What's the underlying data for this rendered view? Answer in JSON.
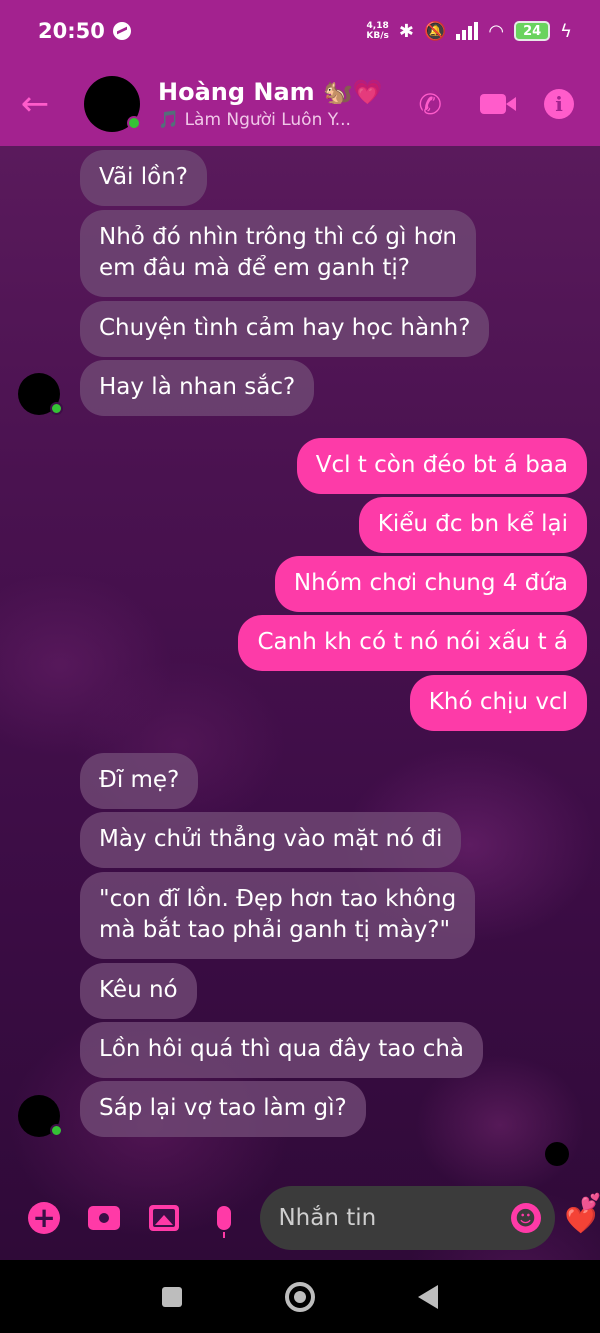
{
  "status_bar": {
    "time": "20:50",
    "net_speed_value": "4,18",
    "net_speed_unit": "KB/s",
    "battery": "24"
  },
  "header": {
    "name": "Hoàng Nam 🐿️💗",
    "subtitle": "🎵 Làm Người Luôn Y...",
    "back_icon": "back-arrow-icon",
    "call_icon": "phone-icon",
    "video_icon": "video-icon",
    "info_icon": "info-icon"
  },
  "messages": [
    {
      "side": "in",
      "text": "Vãi lồn?"
    },
    {
      "side": "in",
      "text": "Nhỏ đó nhìn trông thì có gì hơn\nem đâu mà để em ganh tị?"
    },
    {
      "side": "in",
      "text": "Chuyện tình cảm hay học hành?"
    },
    {
      "side": "in",
      "text": "Hay là nhan sắc?"
    },
    {
      "side": "out",
      "text": "Vcl t còn đéo bt á baa"
    },
    {
      "side": "out",
      "text": "Kiểu đc bn kể lại"
    },
    {
      "side": "out",
      "text": "Nhóm chơi chung 4 đứa"
    },
    {
      "side": "out",
      "text": "Canh kh có t nó nói xấu t á"
    },
    {
      "side": "out",
      "text": "Khó chịu vcl"
    },
    {
      "side": "in",
      "text": "Đĩ mẹ?"
    },
    {
      "side": "in",
      "text": "Mày chửi thẳng vào mặt nó đi"
    },
    {
      "side": "in",
      "text": "\"con đĩ lồn. Đẹp hơn tao không\nmà bắt tao phải ganh tị mày?\""
    },
    {
      "side": "in",
      "text": "Kêu nó"
    },
    {
      "side": "in",
      "text": "Lồn hôi quá thì qua đây tao chà"
    },
    {
      "side": "in",
      "text": "Sáp lại vợ tao làm gì?"
    }
  ],
  "composer": {
    "placeholder": "Nhắn tin",
    "plus_icon": "plus-icon",
    "camera_icon": "camera-icon",
    "gallery_icon": "image-icon",
    "mic_icon": "microphone-icon",
    "emoji_icon": "emoji-icon",
    "quick_reaction": "❤️",
    "quick_reaction_small": "💕"
  },
  "colors": {
    "header_bg": "#a3228f",
    "accent": "#ff3aa7",
    "outgoing_bubble": "#fd3ba8",
    "incoming_bubble": "#6e4673"
  }
}
